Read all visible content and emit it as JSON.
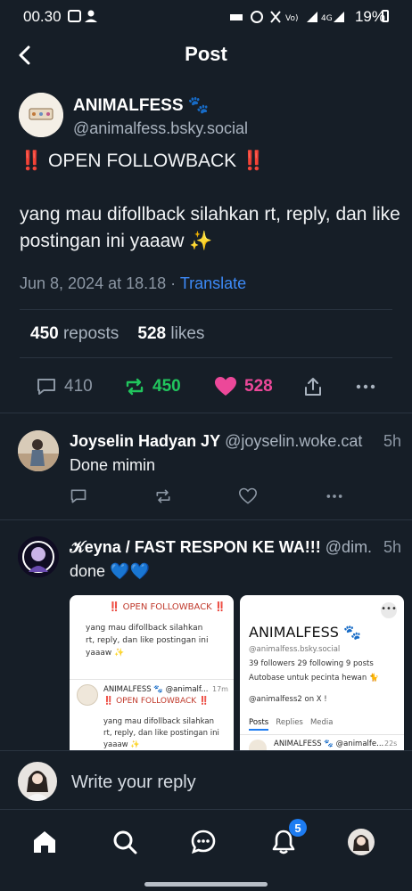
{
  "status_bar": {
    "time": "00.30",
    "battery": "19%"
  },
  "header": {
    "title": "Post"
  },
  "post": {
    "author_name": "ANIMALFESS 🐾",
    "author_handle": "@animalfess.bsky.social",
    "text": "‼️ OPEN FOLLOWBACK ‼️\n\nyang mau difollback silahkan rt, reply, dan like postingan ini yaaaw ✨",
    "date": "Jun 8, 2024 at 18.18",
    "translate_label": "Translate",
    "reposts_count": "450",
    "reposts_label": "reposts",
    "likes_count": "528",
    "likes_label": "likes",
    "reply_count": "410",
    "repost_count": "450",
    "like_count": "528"
  },
  "replies": [
    {
      "name": "Joyselin Hadyan JY",
      "handle": "@joyselin.woke.cat",
      "time": "5h",
      "text": "Done mimin"
    },
    {
      "name": "𝒦eyna / FAST RESPON KE WA!!!",
      "handle": "@dim...",
      "time": "5h",
      "text": "done 💙💙"
    }
  ],
  "embed_left": {
    "line1": "‼️ OPEN FOLLOWBACK ‼️",
    "line2": "yang mau difollback silahkan",
    "line3": "rt, reply, dan like postingan ini",
    "line4": "yaaaw ✨",
    "name": "ANIMALFESS 🐾 @animalf...",
    "time": "17m",
    "quote1": "‼️ OPEN FOLLOWBACK ‼️",
    "quote2": "yang mau difollback silahkan",
    "quote3": "rt, reply, dan like postingan ini",
    "quote4": "yaaaw ✨"
  },
  "embed_right": {
    "title": "ANIMALFESS 🐾",
    "handle": "@animalfess.bsky.social",
    "followers": "39 followers",
    "following": "29 following",
    "posts": "9 posts",
    "bio": "Autobase untuk pecinta hewan 🐈",
    "link": "@animalfess2 on X !",
    "tab_posts": "Posts",
    "tab_replies": "Replies",
    "tab_media": "Media",
    "preview": "ANIMALFESS 🐾 @animalfe...",
    "preview_time": "22s"
  },
  "composer": {
    "placeholder": "Write your reply"
  },
  "nav": {
    "notification_badge": "5"
  },
  "colors": {
    "background": "#161e27",
    "accent": "#3d8af7",
    "repost": "#21c55d",
    "like": "#ec4899"
  }
}
